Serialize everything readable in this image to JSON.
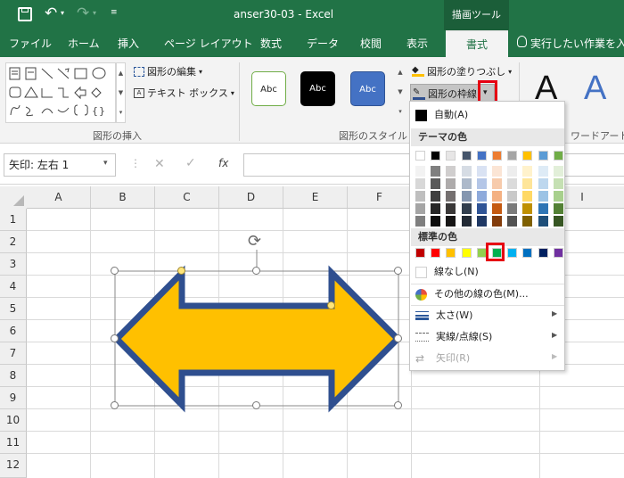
{
  "titlebar": {
    "doc_title": "anser30-03 - Excel",
    "context_tab": "描画ツール"
  },
  "tabs": [
    "ファイル",
    "ホーム",
    "挿入",
    "ページ レイアウト",
    "数式",
    "データ",
    "校閲",
    "表示",
    "書式"
  ],
  "tell_me": "実行したい作業を入力",
  "ribbon": {
    "insert_group_label": "図形の挿入",
    "edit_shape": "図形の編集",
    "text_box": "テキスト ボックス",
    "style_group_label": "図形のスタイル",
    "style_sample": "Abc",
    "fill": "図形の塗りつぶし",
    "outline": "図形の枠線",
    "wordart_label": "ワードアートの",
    "wordart_sample": "A"
  },
  "formula_bar": {
    "name_box": "矢印: 左右 1",
    "fx": "fx"
  },
  "columns": [
    "A",
    "B",
    "C",
    "D",
    "E",
    "F",
    "",
    "",
    "I"
  ],
  "rows": [
    "1",
    "2",
    "3",
    "4",
    "5",
    "6",
    "7",
    "8",
    "9",
    "10",
    "11",
    "12"
  ],
  "dropdown": {
    "auto": "自動(A)",
    "theme_header": "テーマの色",
    "standard_header": "標準の色",
    "no_line": "線なし(N)",
    "more_colors": "その他の線の色(M)...",
    "weight": "太さ(W)",
    "dashes": "実線/点線(S)",
    "arrows": "矢印(R)"
  },
  "colors": {
    "theme_top": [
      "#ffffff",
      "#000000",
      "#e7e6e6",
      "#44546a",
      "#4472c4",
      "#ed7d31",
      "#a5a5a5",
      "#ffc000",
      "#5b9bd5",
      "#70ad47"
    ],
    "theme_shades": [
      [
        "#f2f2f2",
        "#7f7f7f",
        "#d0cece",
        "#d6dce4",
        "#d9e2f3",
        "#fbe5d5",
        "#ededed",
        "#fff2cc",
        "#deebf6",
        "#e2efd9"
      ],
      [
        "#d8d8d8",
        "#595959",
        "#aeabab",
        "#adb9ca",
        "#b4c6e7",
        "#f7cbac",
        "#dbdbdb",
        "#fee599",
        "#bdd7ee",
        "#c5e0b3"
      ],
      [
        "#bfbfbf",
        "#3f3f3f",
        "#757070",
        "#8496b0",
        "#8eaadb",
        "#f4b183",
        "#c9c9c9",
        "#ffd965",
        "#9cc3e5",
        "#a8d08d"
      ],
      [
        "#a5a5a5",
        "#262626",
        "#3a3838",
        "#323f4f",
        "#2f5496",
        "#c55a11",
        "#7b7b7b",
        "#bf9000",
        "#2e75b5",
        "#538135"
      ],
      [
        "#7f7f7f",
        "#0c0c0c",
        "#171616",
        "#222a35",
        "#1f3864",
        "#833c0b",
        "#525252",
        "#7f6000",
        "#1e4e79",
        "#375623"
      ]
    ],
    "standard": [
      "#c00000",
      "#ff0000",
      "#ffc000",
      "#ffff00",
      "#92d050",
      "#00b050",
      "#00b0f0",
      "#0070c0",
      "#002060",
      "#7030a0"
    ],
    "shape_fill": "#ffc000",
    "shape_outline": "#2f4f8f",
    "excel_green": "#217346",
    "highlight": "#e60012"
  }
}
